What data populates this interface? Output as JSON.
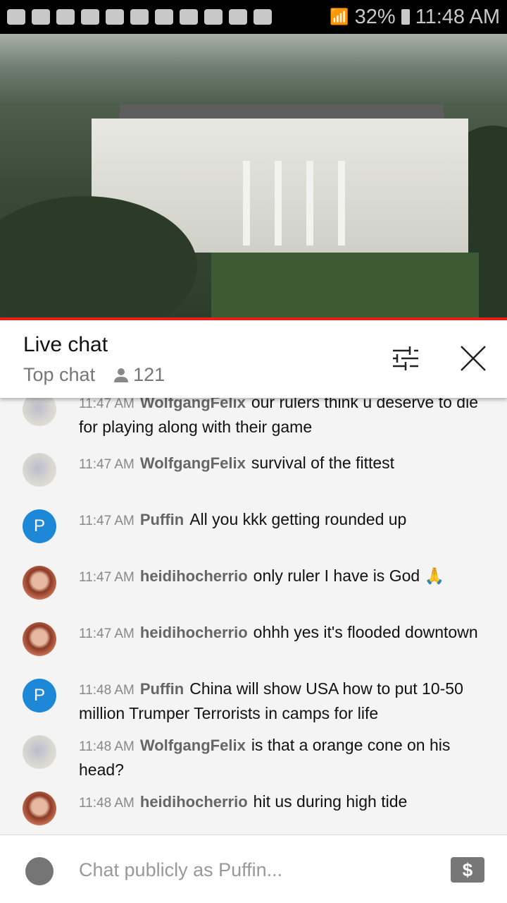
{
  "status_bar": {
    "battery": "32%",
    "time": "11:48 AM",
    "notification_icons": [
      "message-icon",
      "youtube-icon",
      "youtube-icon",
      "youtube-icon",
      "crown-icon",
      "crown-icon",
      "folder-icon",
      "warning-icon",
      "image-icon",
      "calendar-icon",
      "play-store-icon"
    ]
  },
  "video": {
    "scene": "live stream video"
  },
  "header": {
    "title": "Live chat",
    "mode": "Top chat",
    "viewers": "121"
  },
  "messages": [
    {
      "time": "11:47 AM",
      "author": "WolfgangFelix",
      "text": "our rulers think u deserve to die for playing along with their game",
      "avatar": "w"
    },
    {
      "time": "11:47 AM",
      "author": "WolfgangFelix",
      "text": "survival of the fittest",
      "avatar": "w"
    },
    {
      "time": "11:47 AM",
      "author": "Puffin",
      "text": "All you kkk getting rounded up",
      "avatar": "p",
      "initial": "P"
    },
    {
      "time": "11:47 AM",
      "author": "heidihocherrio",
      "text": "only ruler I have is God 🙏",
      "avatar": "h"
    },
    {
      "time": "11:47 AM",
      "author": "heidihocherrio",
      "text": "ohhh yes it's flooded downtown",
      "avatar": "h"
    },
    {
      "time": "11:48 AM",
      "author": "Puffin",
      "text": "China will show USA how to put 10-50 million Trumper Terrorists in camps for life",
      "avatar": "p",
      "initial": "P"
    },
    {
      "time": "11:48 AM",
      "author": "WolfgangFelix",
      "text": "is that a orange cone on his head?",
      "avatar": "w"
    },
    {
      "time": "11:48 AM",
      "author": "heidihocherrio",
      "text": "hit us during high tide",
      "avatar": "h"
    }
  ],
  "input": {
    "placeholder": "Chat publicly as Puffin...",
    "super_chat": "$"
  },
  "colors": {
    "accent": "#e62117",
    "puffin_avatar": "#1e88d8"
  }
}
